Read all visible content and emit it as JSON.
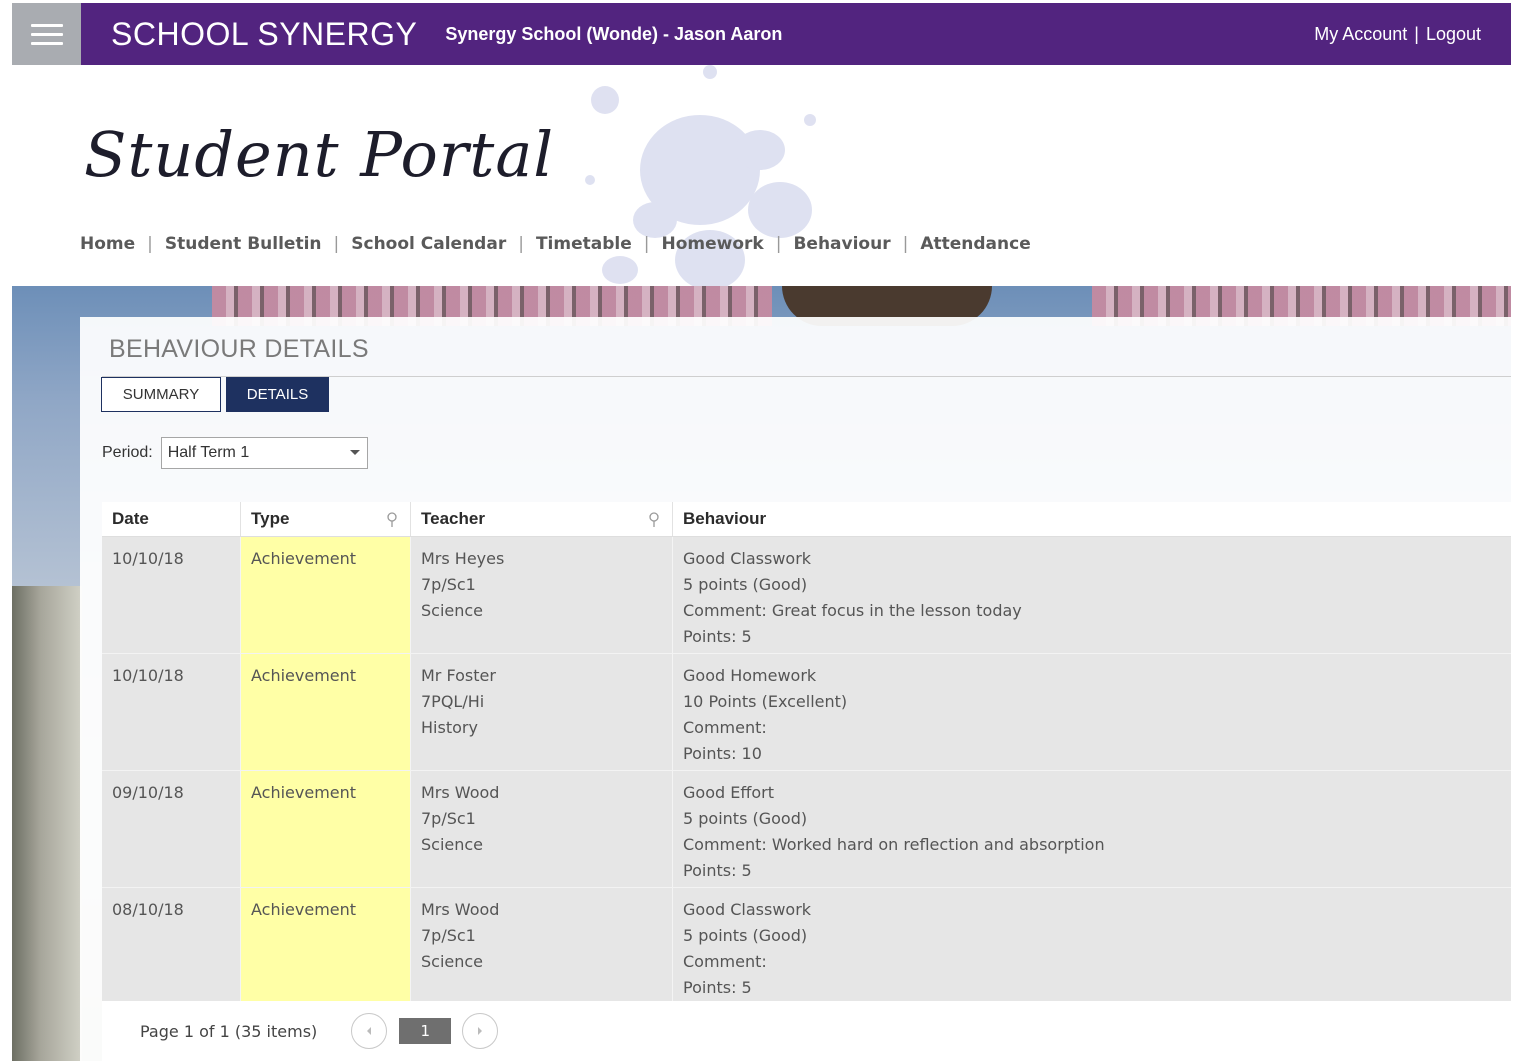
{
  "header": {
    "brand": "SCHOOL SYNERGY",
    "school_user": "Synergy School (Wonde) - Jason Aaron",
    "my_account": "My Account",
    "separator": "|",
    "logout": "Logout",
    "accent_color": "#52247f"
  },
  "portal_title": "Student Portal",
  "nav": {
    "items": [
      {
        "label": "Home"
      },
      {
        "label": "Student Bulletin"
      },
      {
        "label": "School Calendar"
      },
      {
        "label": "Timetable"
      },
      {
        "label": "Homework"
      },
      {
        "label": "Behaviour"
      },
      {
        "label": "Attendance"
      }
    ],
    "separator": "|"
  },
  "page": {
    "title": "BEHAVIOUR DETAILS",
    "tabs": [
      {
        "label": "SUMMARY",
        "active": false
      },
      {
        "label": "DETAILS",
        "active": true
      }
    ],
    "period": {
      "label": "Period:",
      "selected": "Half Term 1"
    }
  },
  "grid": {
    "columns": [
      "Date",
      "Type",
      "Teacher",
      "Behaviour"
    ],
    "rows": [
      {
        "date": "10/10/18",
        "type": "Achievement",
        "teacher": [
          "Mrs Heyes",
          "7p/Sc1",
          "Science"
        ],
        "behaviour": [
          "Good Classwork",
          "5 points (Good)",
          "Comment: Great focus in the lesson today",
          "Points: 5"
        ]
      },
      {
        "date": "10/10/18",
        "type": "Achievement",
        "teacher": [
          "Mr Foster",
          "7PQL/Hi",
          "History"
        ],
        "behaviour": [
          "Good Homework",
          "10 Points (Excellent)",
          "Comment:",
          "Points: 10"
        ]
      },
      {
        "date": "09/10/18",
        "type": "Achievement",
        "teacher": [
          "Mrs Wood",
          "7p/Sc1",
          "Science"
        ],
        "behaviour": [
          "Good Effort",
          "5 points (Good)",
          "Comment: Worked hard on reflection and absorption",
          "Points: 5"
        ]
      },
      {
        "date": "08/10/18",
        "type": "Achievement",
        "teacher": [
          "Mrs Wood",
          "7p/Sc1",
          "Science"
        ],
        "behaviour": [
          "Good Classwork",
          "5 points (Good)",
          "Comment:",
          "Points: 5"
        ]
      }
    ],
    "type_highlight_color": "#ffffa6"
  },
  "pager": {
    "info": "Page 1 of 1 (35 items)",
    "current_page": "1",
    "prev_icon": "chevron-left-icon",
    "next_icon": "chevron-right-icon"
  }
}
